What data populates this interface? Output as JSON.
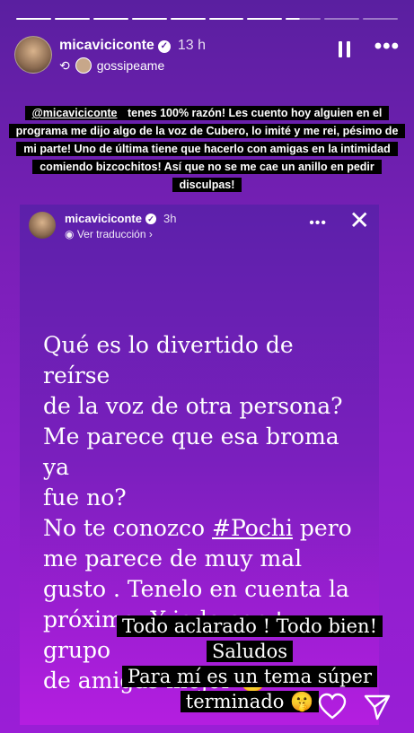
{
  "progress": {
    "total": 10,
    "done": 7,
    "partial_index": 7
  },
  "header": {
    "username": "micaviciconte",
    "time": "13 h",
    "reposted_from": "gossipeame"
  },
  "caption": {
    "mention": "@micaviciconte",
    "text": " tenes 100% razón! Les cuento hoy alguien en el programa me dijo algo de la voz de Cubero, lo imité y me rei, pésimo de mi parte! Uno de última tiene que hacerlo con amigas en la intimidad comiendo bizcochitos! Así que no se me cae un anillo en pedir disculpas!"
  },
  "card": {
    "username": "micaviciconte",
    "time": "3h",
    "translate": "Ver traducción ›",
    "lines": [
      "Qué es lo divertido de reírse",
      "de la voz de otra persona?",
      "Me parece que esa broma ya",
      "fue no?",
      "No te conozco ",
      " pero",
      "me parece de muy mal",
      "gusto . Tenelo en cuenta la",
      "próxima. Y jode con tu grupo",
      "de amigas mejor 😉"
    ],
    "hashtag": "#Pochi"
  },
  "answer": {
    "lines": [
      "Todo aclarado ! Todo bien!",
      "Saludos",
      "Para mí es un tema súper",
      "terminado 🤫"
    ]
  },
  "icons": [
    "pause-icon",
    "more-icon",
    "repost-icon",
    "verified-icon",
    "close-icon",
    "heart-icon",
    "send-icon"
  ]
}
